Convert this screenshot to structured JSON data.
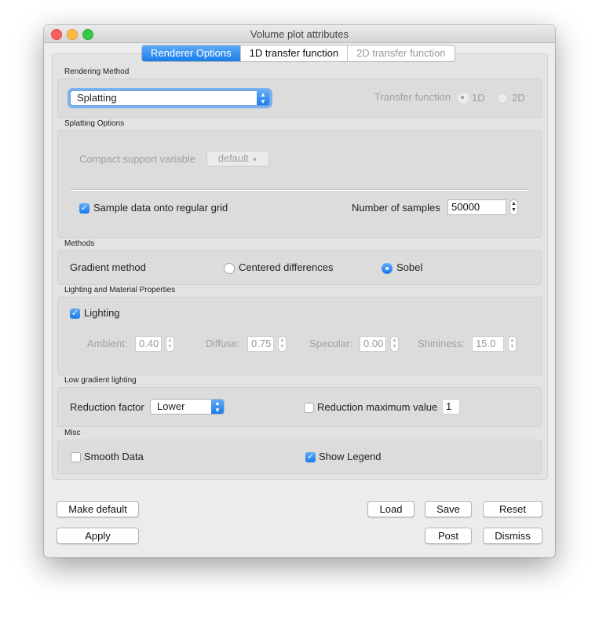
{
  "window": {
    "title": "Volume plot attributes"
  },
  "tabs": [
    {
      "label": "Renderer Options"
    },
    {
      "label": "1D transfer function"
    },
    {
      "label": "2D transfer function"
    }
  ],
  "rendering_method": {
    "section": "Rendering Method",
    "combo_value": "Splatting",
    "transfer_function_label": "Transfer function",
    "option_1d": "1D",
    "option_2d": "2D",
    "selected": "1D"
  },
  "splatting": {
    "section": "Splatting Options",
    "compact_label": "Compact support variable",
    "compact_value": "default",
    "sample_label": "Sample data onto regular grid",
    "sample_checked": true,
    "samples_label": "Number of samples",
    "samples_value": "50000"
  },
  "methods": {
    "section": "Methods",
    "gradient_label": "Gradient method",
    "centered_label": "Centered differences",
    "sobel_label": "Sobel",
    "selected": "Sobel"
  },
  "lighting": {
    "section": "Lighting and Material Properties",
    "lighting_label": "Lighting",
    "lighting_checked": true,
    "ambient_label": "Ambient:",
    "ambient_value": "0.40",
    "diffuse_label": "Diffuse:",
    "diffuse_value": "0.75",
    "specular_label": "Specular:",
    "specular_value": "0.00",
    "shininess_label": "Shininess:",
    "shininess_value": "15.0"
  },
  "low_gradient": {
    "section": "Low gradient lighting",
    "reduction_label": "Reduction factor",
    "reduction_value": "Lower",
    "max_label": "Reduction maximum value",
    "max_checked": false,
    "max_value": "1"
  },
  "misc": {
    "section": "Misc",
    "smooth_label": "Smooth Data",
    "smooth_checked": false,
    "legend_label": "Show Legend",
    "legend_checked": true
  },
  "buttons": {
    "make_default": "Make default",
    "apply": "Apply",
    "load": "Load",
    "save": "Save",
    "reset": "Reset",
    "post": "Post",
    "dismiss": "Dismiss"
  },
  "colors": {
    "accent": "#1a7de8",
    "close": "#fc605c",
    "minimize": "#fdbc40",
    "zoom": "#34c84a"
  }
}
